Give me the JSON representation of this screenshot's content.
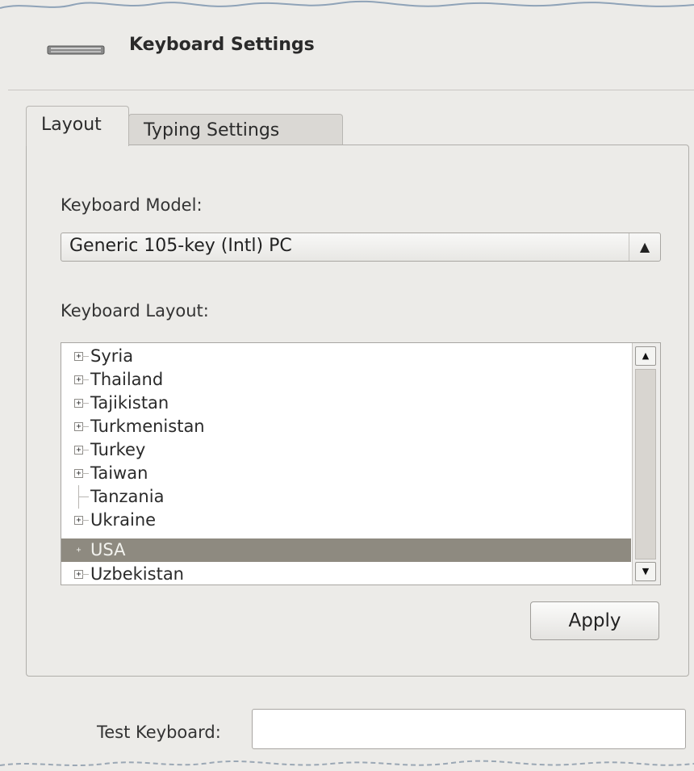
{
  "header": {
    "title": "Keyboard Settings",
    "icon": "keyboard-icon"
  },
  "tabs": [
    {
      "label": "Layout",
      "active": true
    },
    {
      "label": "Typing Settings",
      "active": false
    }
  ],
  "layout_tab": {
    "model_label": "Keyboard Model:",
    "model_value": "Generic 105-key (Intl) PC",
    "layout_label": "Keyboard Layout:",
    "layouts": [
      {
        "label": "Syria",
        "expandable": true,
        "selected": false
      },
      {
        "label": "Thailand",
        "expandable": true,
        "selected": false
      },
      {
        "label": "Tajikistan",
        "expandable": true,
        "selected": false
      },
      {
        "label": "Turkmenistan",
        "expandable": true,
        "selected": false
      },
      {
        "label": "Turkey",
        "expandable": true,
        "selected": false
      },
      {
        "label": "Taiwan",
        "expandable": true,
        "selected": false
      },
      {
        "label": "Tanzania",
        "expandable": false,
        "selected": false
      },
      {
        "label": "Ukraine",
        "expandable": true,
        "selected": false
      },
      {
        "label": "USA",
        "expandable": true,
        "selected": true
      },
      {
        "label": "Uzbekistan",
        "expandable": true,
        "selected": false
      }
    ],
    "apply_label": "Apply"
  },
  "test": {
    "label": "Test Keyboard:",
    "value": ""
  },
  "colors": {
    "selection": "#8e8a80",
    "window_bg": "#ecebe8"
  }
}
